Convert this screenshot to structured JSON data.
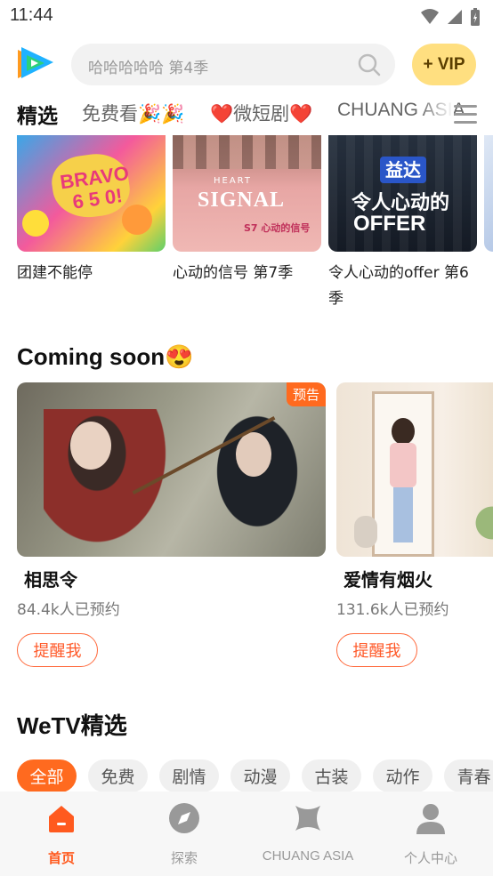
{
  "status_bar": {
    "time": "11:44"
  },
  "header": {
    "search_placeholder": "哈哈哈哈哈 第4季",
    "vip_label": "+ VIP"
  },
  "tabs": [
    {
      "label": "精选",
      "active": true
    },
    {
      "label": "免费看🎉🎉",
      "active": false
    },
    {
      "label": "❤️微短剧❤️",
      "active": false
    },
    {
      "label": "CHUANG ASIA",
      "active": false
    }
  ],
  "top_row": [
    {
      "title": "团建不能停"
    },
    {
      "title": "心动的信号 第7季"
    },
    {
      "title": "令人心动的offer 第6季"
    }
  ],
  "coming_soon": {
    "heading": "Coming soon😍",
    "items": [
      {
        "badge": "预告",
        "name": "相思令",
        "count": "84.4k人已预约",
        "button": "提醒我"
      },
      {
        "badge": "",
        "name": "爱情有烟火",
        "count": "131.6k人已预约",
        "button": "提醒我"
      }
    ]
  },
  "wetv": {
    "heading": "WeTV精选",
    "chips": [
      "全部",
      "免费",
      "剧情",
      "动漫",
      "古装",
      "动作",
      "青春"
    ]
  },
  "bottom_nav": [
    {
      "label": "首页",
      "icon": "home-icon",
      "active": true
    },
    {
      "label": "探索",
      "icon": "compass-icon",
      "active": false
    },
    {
      "label": "CHUANG ASIA",
      "icon": "chuang-asia-icon",
      "active": false
    },
    {
      "label": "个人中心",
      "icon": "person-icon",
      "active": false
    }
  ],
  "colors": {
    "accent": "#ff6a1f",
    "vip": "#ffdf80"
  }
}
